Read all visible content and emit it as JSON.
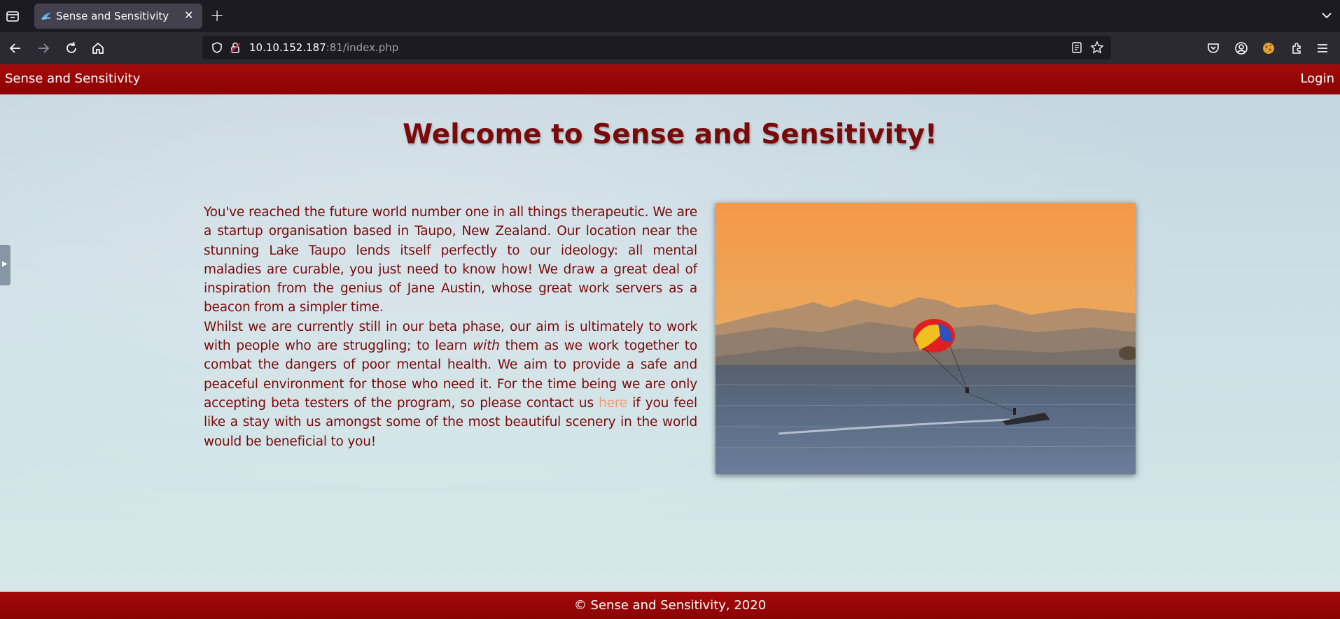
{
  "browser": {
    "tab": {
      "title": "Sense and Sensitivity"
    },
    "url": {
      "host": "10.10.152.187",
      "rest": ":81/index.php"
    }
  },
  "site": {
    "brand": "Sense and Sensitivity",
    "login_label": "Login",
    "welcome": "Welcome to Sense and Sensitivity!",
    "intro": {
      "p1": "You've reached the future world number one in all things therapeutic. We are a startup organisation based in Taupo, New Zealand. Our location near the stunning Lake Taupo lends itself perfectly to our ideology: all mental maladies are curable, you just need to know how! We draw a great deal of inspiration from the genius of Jane Austin, whose great work servers as a beacon from a simpler time.",
      "p2_a": "Whilst we are currently still in our beta phase, our aim is ultimately to work with people who are struggling; to learn ",
      "p2_em": "with",
      "p2_b": " them as we work together to combat the dangers of poor mental health. We aim to provide a safe and peaceful environment for those who need it. For the time being we are only accepting beta testers of the program, so please contact us ",
      "p2_link": "here",
      "p2_c": " if you feel like a stay with us amongst some of the most beautiful scenery in the world would be beneficial to you!"
    },
    "footer": "© Sense and Sensitivity, 2020"
  },
  "colors": {
    "header_red": "#a60a0a",
    "text_red": "#7a0a0a",
    "link_orange": "#f0a070"
  }
}
